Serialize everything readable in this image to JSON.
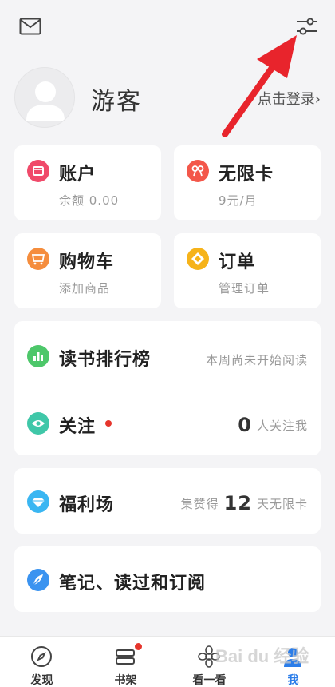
{
  "profile": {
    "name": "游客",
    "login_link": "点击登录›"
  },
  "cards": {
    "account": {
      "title": "账户",
      "subtitle": "余额 0.00",
      "icon_color": "#f04a6a"
    },
    "unlimited": {
      "title": "无限卡",
      "subtitle": "9元/月",
      "icon_color": "#f3574a"
    },
    "cart": {
      "title": "购物车",
      "subtitle": "添加商品",
      "icon_color": "#f58d3d"
    },
    "orders": {
      "title": "订单",
      "subtitle": "管理订单",
      "icon_color": "#f6b31a"
    }
  },
  "rows": {
    "ranking": {
      "title": "读书排行榜",
      "right": "本周尚未开始阅读",
      "icon_color": "#4dc76a"
    },
    "follow": {
      "title": "关注",
      "count": "0",
      "right": "人关注我",
      "icon_color": "#3fc7a8"
    },
    "welfare": {
      "prefix": "集赞得",
      "count": "12",
      "suffix": "天无限卡",
      "title": "福利场",
      "icon_color": "#3ab6f2"
    },
    "notes": {
      "title": "笔记、读过和订阅",
      "icon_color": "#3a93f0"
    }
  },
  "nav": [
    {
      "label": "发现",
      "icon": "compass-icon"
    },
    {
      "label": "书架",
      "icon": "bookshelf-icon"
    },
    {
      "label": "看一看",
      "icon": "flower-icon"
    },
    {
      "label": "我",
      "icon": "person-icon"
    }
  ],
  "watermark": "Bai du 经验",
  "colors": {
    "accent": "#2b7de9",
    "arrow": "#e8242c",
    "badge": "#e6352c"
  }
}
